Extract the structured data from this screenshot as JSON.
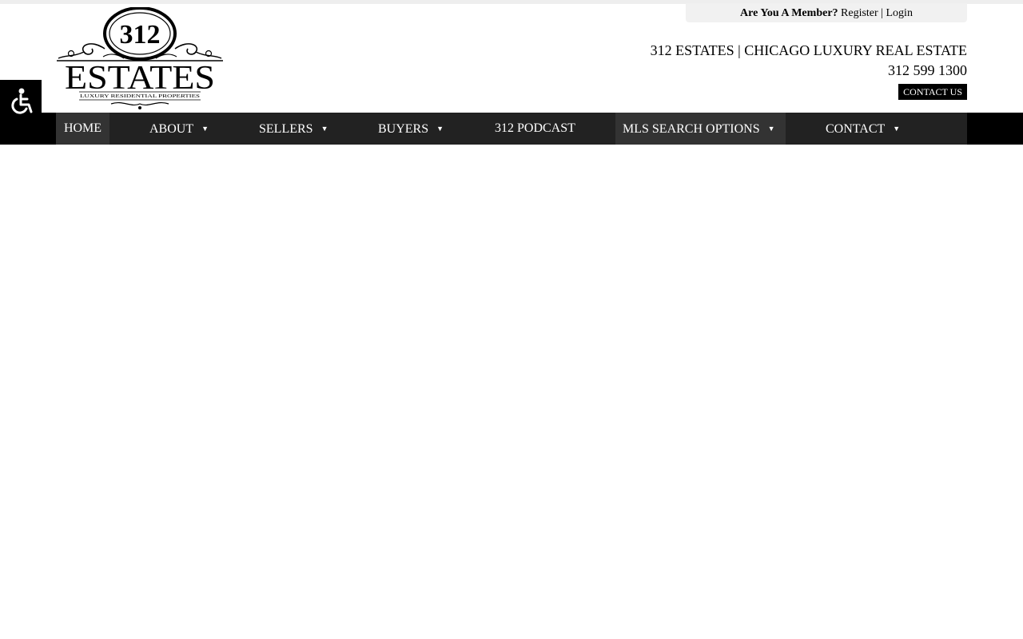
{
  "header": {
    "member_prompt": "Are You A Member?",
    "register_label": "Register",
    "separator": "|",
    "login_label": "Login",
    "tagline": "312 ESTATES | CHICAGO LUXURY REAL ESTATE",
    "phone": "312 599 1300",
    "contact_button": "CONTACT US"
  },
  "logo": {
    "number": "312",
    "name": "ESTATES",
    "subtitle": "LUXURY RESIDENTIAL PROPERTIES"
  },
  "nav": {
    "items": [
      {
        "label": "HOME",
        "dropdown": false
      },
      {
        "label": "ABOUT",
        "dropdown": true
      },
      {
        "label": "SELLERS",
        "dropdown": true
      },
      {
        "label": "BUYERS",
        "dropdown": true
      },
      {
        "label": "312 PODCAST",
        "dropdown": false
      },
      {
        "label": "MLS SEARCH OPTIONS",
        "dropdown": true
      },
      {
        "label": "CONTACT",
        "dropdown": true
      }
    ],
    "caret": "▼"
  },
  "accessibility": {
    "icon": "wheelchair-icon"
  },
  "colors": {
    "nav_bg": "#222222",
    "nav_active_bg": "#333333",
    "accent": "#000000"
  }
}
